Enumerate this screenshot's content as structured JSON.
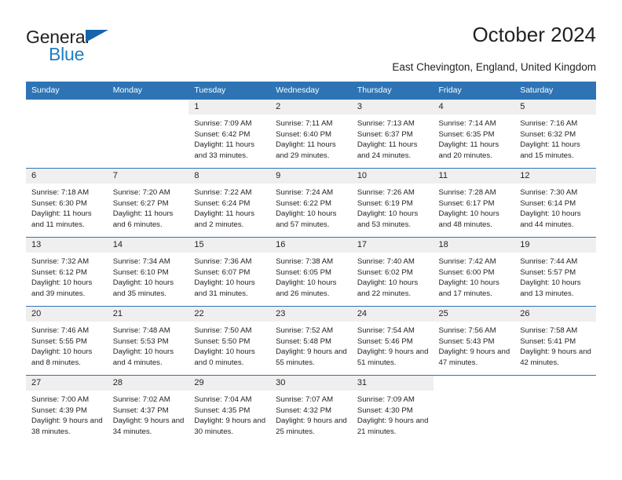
{
  "brand": {
    "name_part1": "General",
    "name_part2": "Blue",
    "triangle_color": "#1665ab",
    "blue_color": "#1f7fc4"
  },
  "header": {
    "title": "October 2024",
    "subtitle": "East Chevington, England, United Kingdom"
  },
  "theme": {
    "header_blue": "#2e74b5",
    "daynum_gray": "#efefef",
    "text": "#231f20"
  },
  "weekday_headers": [
    "Sunday",
    "Monday",
    "Tuesday",
    "Wednesday",
    "Thursday",
    "Friday",
    "Saturday"
  ],
  "weeks": [
    [
      {
        "blank": true
      },
      {
        "blank": true
      },
      {
        "day": "1",
        "sunrise": "Sunrise: 7:09 AM",
        "sunset": "Sunset: 6:42 PM",
        "daylight": "Daylight: 11 hours and 33 minutes."
      },
      {
        "day": "2",
        "sunrise": "Sunrise: 7:11 AM",
        "sunset": "Sunset: 6:40 PM",
        "daylight": "Daylight: 11 hours and 29 minutes."
      },
      {
        "day": "3",
        "sunrise": "Sunrise: 7:13 AM",
        "sunset": "Sunset: 6:37 PM",
        "daylight": "Daylight: 11 hours and 24 minutes."
      },
      {
        "day": "4",
        "sunrise": "Sunrise: 7:14 AM",
        "sunset": "Sunset: 6:35 PM",
        "daylight": "Daylight: 11 hours and 20 minutes."
      },
      {
        "day": "5",
        "sunrise": "Sunrise: 7:16 AM",
        "sunset": "Sunset: 6:32 PM",
        "daylight": "Daylight: 11 hours and 15 minutes."
      }
    ],
    [
      {
        "day": "6",
        "sunrise": "Sunrise: 7:18 AM",
        "sunset": "Sunset: 6:30 PM",
        "daylight": "Daylight: 11 hours and 11 minutes."
      },
      {
        "day": "7",
        "sunrise": "Sunrise: 7:20 AM",
        "sunset": "Sunset: 6:27 PM",
        "daylight": "Daylight: 11 hours and 6 minutes."
      },
      {
        "day": "8",
        "sunrise": "Sunrise: 7:22 AM",
        "sunset": "Sunset: 6:24 PM",
        "daylight": "Daylight: 11 hours and 2 minutes."
      },
      {
        "day": "9",
        "sunrise": "Sunrise: 7:24 AM",
        "sunset": "Sunset: 6:22 PM",
        "daylight": "Daylight: 10 hours and 57 minutes."
      },
      {
        "day": "10",
        "sunrise": "Sunrise: 7:26 AM",
        "sunset": "Sunset: 6:19 PM",
        "daylight": "Daylight: 10 hours and 53 minutes."
      },
      {
        "day": "11",
        "sunrise": "Sunrise: 7:28 AM",
        "sunset": "Sunset: 6:17 PM",
        "daylight": "Daylight: 10 hours and 48 minutes."
      },
      {
        "day": "12",
        "sunrise": "Sunrise: 7:30 AM",
        "sunset": "Sunset: 6:14 PM",
        "daylight": "Daylight: 10 hours and 44 minutes."
      }
    ],
    [
      {
        "day": "13",
        "sunrise": "Sunrise: 7:32 AM",
        "sunset": "Sunset: 6:12 PM",
        "daylight": "Daylight: 10 hours and 39 minutes."
      },
      {
        "day": "14",
        "sunrise": "Sunrise: 7:34 AM",
        "sunset": "Sunset: 6:10 PM",
        "daylight": "Daylight: 10 hours and 35 minutes."
      },
      {
        "day": "15",
        "sunrise": "Sunrise: 7:36 AM",
        "sunset": "Sunset: 6:07 PM",
        "daylight": "Daylight: 10 hours and 31 minutes."
      },
      {
        "day": "16",
        "sunrise": "Sunrise: 7:38 AM",
        "sunset": "Sunset: 6:05 PM",
        "daylight": "Daylight: 10 hours and 26 minutes."
      },
      {
        "day": "17",
        "sunrise": "Sunrise: 7:40 AM",
        "sunset": "Sunset: 6:02 PM",
        "daylight": "Daylight: 10 hours and 22 minutes."
      },
      {
        "day": "18",
        "sunrise": "Sunrise: 7:42 AM",
        "sunset": "Sunset: 6:00 PM",
        "daylight": "Daylight: 10 hours and 17 minutes."
      },
      {
        "day": "19",
        "sunrise": "Sunrise: 7:44 AM",
        "sunset": "Sunset: 5:57 PM",
        "daylight": "Daylight: 10 hours and 13 minutes."
      }
    ],
    [
      {
        "day": "20",
        "sunrise": "Sunrise: 7:46 AM",
        "sunset": "Sunset: 5:55 PM",
        "daylight": "Daylight: 10 hours and 8 minutes."
      },
      {
        "day": "21",
        "sunrise": "Sunrise: 7:48 AM",
        "sunset": "Sunset: 5:53 PM",
        "daylight": "Daylight: 10 hours and 4 minutes."
      },
      {
        "day": "22",
        "sunrise": "Sunrise: 7:50 AM",
        "sunset": "Sunset: 5:50 PM",
        "daylight": "Daylight: 10 hours and 0 minutes."
      },
      {
        "day": "23",
        "sunrise": "Sunrise: 7:52 AM",
        "sunset": "Sunset: 5:48 PM",
        "daylight": "Daylight: 9 hours and 55 minutes."
      },
      {
        "day": "24",
        "sunrise": "Sunrise: 7:54 AM",
        "sunset": "Sunset: 5:46 PM",
        "daylight": "Daylight: 9 hours and 51 minutes."
      },
      {
        "day": "25",
        "sunrise": "Sunrise: 7:56 AM",
        "sunset": "Sunset: 5:43 PM",
        "daylight": "Daylight: 9 hours and 47 minutes."
      },
      {
        "day": "26",
        "sunrise": "Sunrise: 7:58 AM",
        "sunset": "Sunset: 5:41 PM",
        "daylight": "Daylight: 9 hours and 42 minutes."
      }
    ],
    [
      {
        "day": "27",
        "sunrise": "Sunrise: 7:00 AM",
        "sunset": "Sunset: 4:39 PM",
        "daylight": "Daylight: 9 hours and 38 minutes."
      },
      {
        "day": "28",
        "sunrise": "Sunrise: 7:02 AM",
        "sunset": "Sunset: 4:37 PM",
        "daylight": "Daylight: 9 hours and 34 minutes."
      },
      {
        "day": "29",
        "sunrise": "Sunrise: 7:04 AM",
        "sunset": "Sunset: 4:35 PM",
        "daylight": "Daylight: 9 hours and 30 minutes."
      },
      {
        "day": "30",
        "sunrise": "Sunrise: 7:07 AM",
        "sunset": "Sunset: 4:32 PM",
        "daylight": "Daylight: 9 hours and 25 minutes."
      },
      {
        "day": "31",
        "sunrise": "Sunrise: 7:09 AM",
        "sunset": "Sunset: 4:30 PM",
        "daylight": "Daylight: 9 hours and 21 minutes."
      },
      {
        "blank": true
      },
      {
        "blank": true
      }
    ]
  ]
}
